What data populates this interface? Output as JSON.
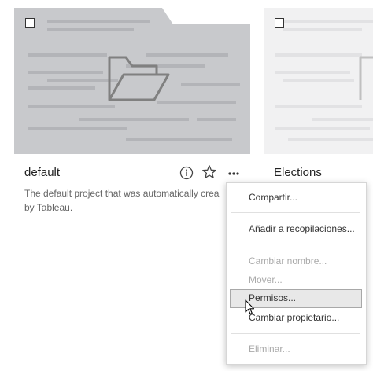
{
  "cards": [
    {
      "title": "default",
      "description": "The default project that was automatically created by Tableau.",
      "description_line1": "The default project that was automatically crea",
      "description_line2": "by Tableau.",
      "thumbnail_icon": "folder-icon",
      "actions": {
        "info_icon": "info-icon",
        "favorite_icon": "star-icon",
        "more_icon": "more-icon"
      }
    },
    {
      "title": "Elections",
      "thumbnail_icon": "folder-icon"
    }
  ],
  "context_menu": {
    "items": [
      {
        "label": "Compartir...",
        "enabled": true
      },
      {
        "label": "Añadir a recopilaciones...",
        "enabled": true
      },
      {
        "label": "Cambiar nombre...",
        "enabled": false
      },
      {
        "label": "Mover...",
        "enabled": false
      },
      {
        "label": "Permisos...",
        "enabled": true,
        "highlighted": true
      },
      {
        "label": "Cambiar propietario...",
        "enabled": true
      },
      {
        "label": "Eliminar...",
        "enabled": false
      }
    ]
  },
  "colors": {
    "thumb_default_bg": "#c8c9cc",
    "thumb_default_lines": "#b3b4b8",
    "thumb_elections_bg": "#f1f1f2",
    "thumb_elections_lines": "#e2e2e4",
    "menu_highlight": "#e8e8e8"
  }
}
